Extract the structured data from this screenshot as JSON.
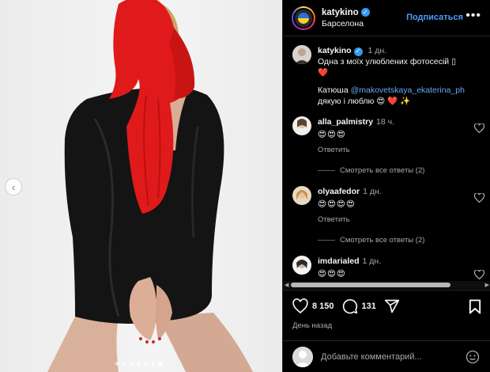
{
  "post": {
    "username": "katykino",
    "location": "Барселона",
    "follow_label": "Подписаться",
    "more_label": "•••"
  },
  "caption": {
    "username": "katykino",
    "time": "1 дн.",
    "line1": "Одна з моїх улюблених фотосесій ",
    "line1_tail": "❤️",
    "line2_prefix": "Катюша ",
    "mention": "@makovetskaya_ekaterina_ph",
    "line3": "дякую і люблю ",
    "line3_emojis": "😍 ❤️ ✨"
  },
  "comments": [
    {
      "username": "alla_palmistry",
      "time": "18 ч.",
      "emojis": "😍😍😍",
      "reply_label": "Ответить",
      "view_replies": "Смотреть все ответы (2)"
    },
    {
      "username": "olyaafedor",
      "time": "1 дн.",
      "emojis": "😍😍😍😍",
      "reply_label": "Ответить",
      "view_replies": "Смотреть все ответы (2)"
    },
    {
      "username": "imdarialed",
      "time": "1 дн.",
      "emojis": "😍😍😍"
    }
  ],
  "actions": {
    "likes": "8 150",
    "comments": "131",
    "date": "День назад"
  },
  "add_comment": {
    "placeholder": "Добавьте комментарий..."
  },
  "carousel": {
    "dot_count": 7,
    "active_index": 6
  },
  "colors": {
    "accent": "#4f9df7",
    "verified": "#3897f0",
    "scarf_red": "#e01a1a",
    "heart_red": "#ed2a35"
  },
  "icons": [
    "chevron-left-icon",
    "verified-icon",
    "more-icon",
    "heart-icon",
    "comment-icon",
    "share-icon",
    "bookmark-icon",
    "emoji-icon"
  ]
}
